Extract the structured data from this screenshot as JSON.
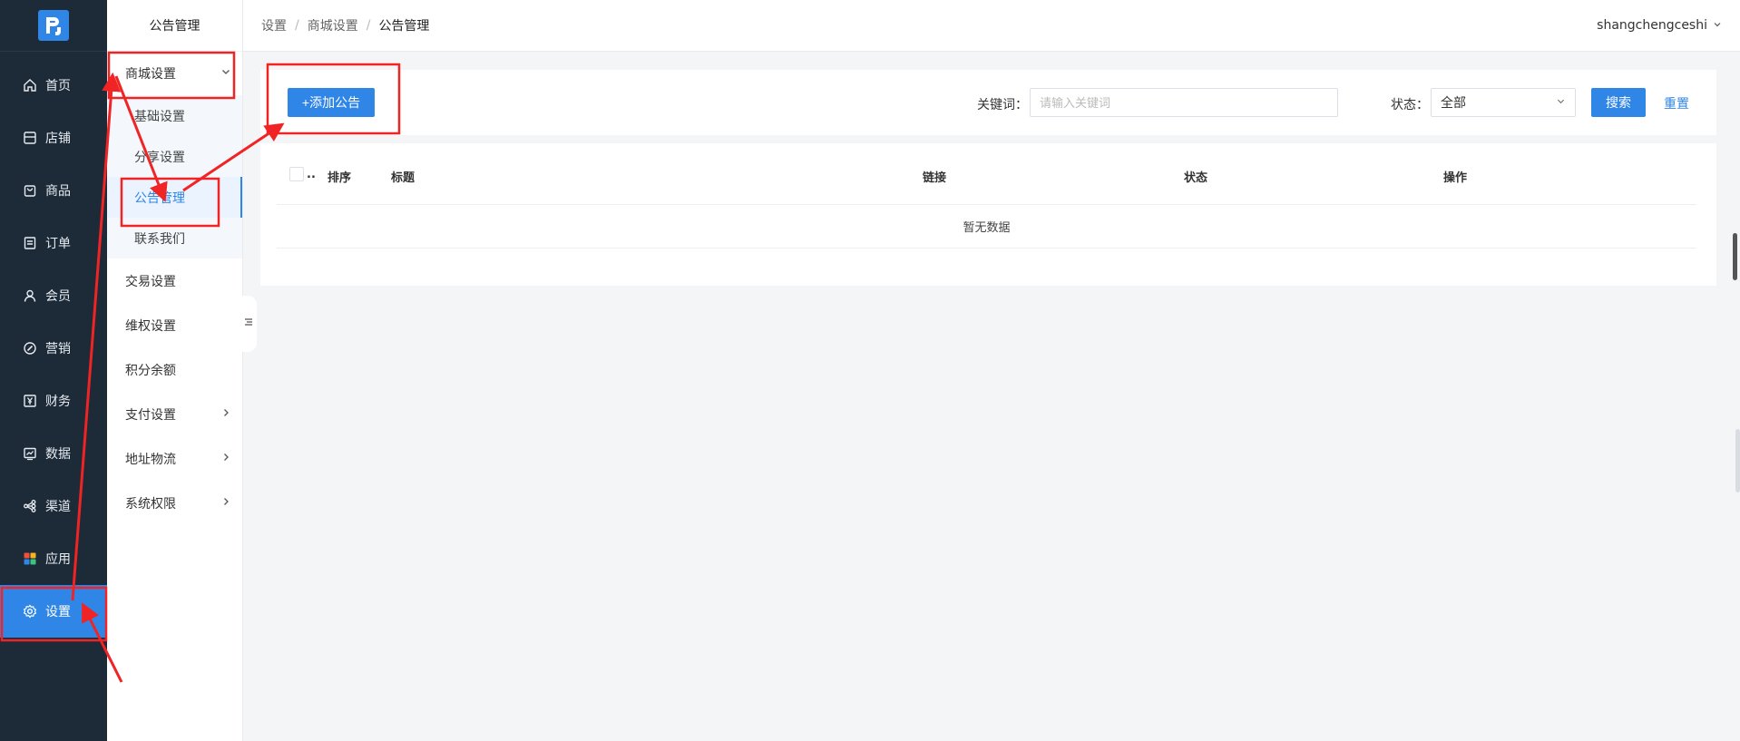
{
  "nav": {
    "logo_icon": "brand-logo-icon",
    "items": [
      {
        "label": "首页",
        "icon": "home-icon"
      },
      {
        "label": "店铺",
        "icon": "store-icon"
      },
      {
        "label": "商品",
        "icon": "bag-icon"
      },
      {
        "label": "订单",
        "icon": "order-icon"
      },
      {
        "label": "会员",
        "icon": "user-icon"
      },
      {
        "label": "营销",
        "icon": "marketing-icon"
      },
      {
        "label": "财务",
        "icon": "yen-icon"
      },
      {
        "label": "数据",
        "icon": "chart-icon"
      },
      {
        "label": "渠道",
        "icon": "share-icon"
      },
      {
        "label": "应用",
        "icon": "apps-icon"
      },
      {
        "label": "设置",
        "icon": "gear-icon"
      }
    ],
    "active": "设置"
  },
  "submenu": {
    "title": "公告管理",
    "group": {
      "label": "商城设置",
      "expanded": true
    },
    "children": [
      "基础设置",
      "分享设置",
      "公告管理",
      "联系我们"
    ],
    "active_child": "公告管理",
    "items": [
      {
        "label": "交易设置",
        "has_arrow": false
      },
      {
        "label": "维权设置",
        "has_arrow": false
      },
      {
        "label": "积分余额",
        "has_arrow": false
      },
      {
        "label": "支付设置",
        "has_arrow": true
      },
      {
        "label": "地址物流",
        "has_arrow": true
      },
      {
        "label": "系统权限",
        "has_arrow": true
      }
    ]
  },
  "header": {
    "breadcrumb": [
      "设置",
      "商城设置",
      "公告管理"
    ],
    "separator": "/",
    "user": "shangchengceshi"
  },
  "filter": {
    "add_label": "+添加公告",
    "keyword_label": "关键词：",
    "keyword_placeholder": "请输入关键词",
    "keyword_value": "",
    "status_label": "状态：",
    "status_value": "全部",
    "search_label": "搜索",
    "reset_label": "重置"
  },
  "table": {
    "columns": [
      "排序",
      "标题",
      "链接",
      "状态",
      "操作"
    ],
    "empty_text": "暂无数据"
  },
  "colors": {
    "nav_bg": "#1d2a38",
    "accent": "#2f86e6",
    "annotation": "#f02424"
  }
}
